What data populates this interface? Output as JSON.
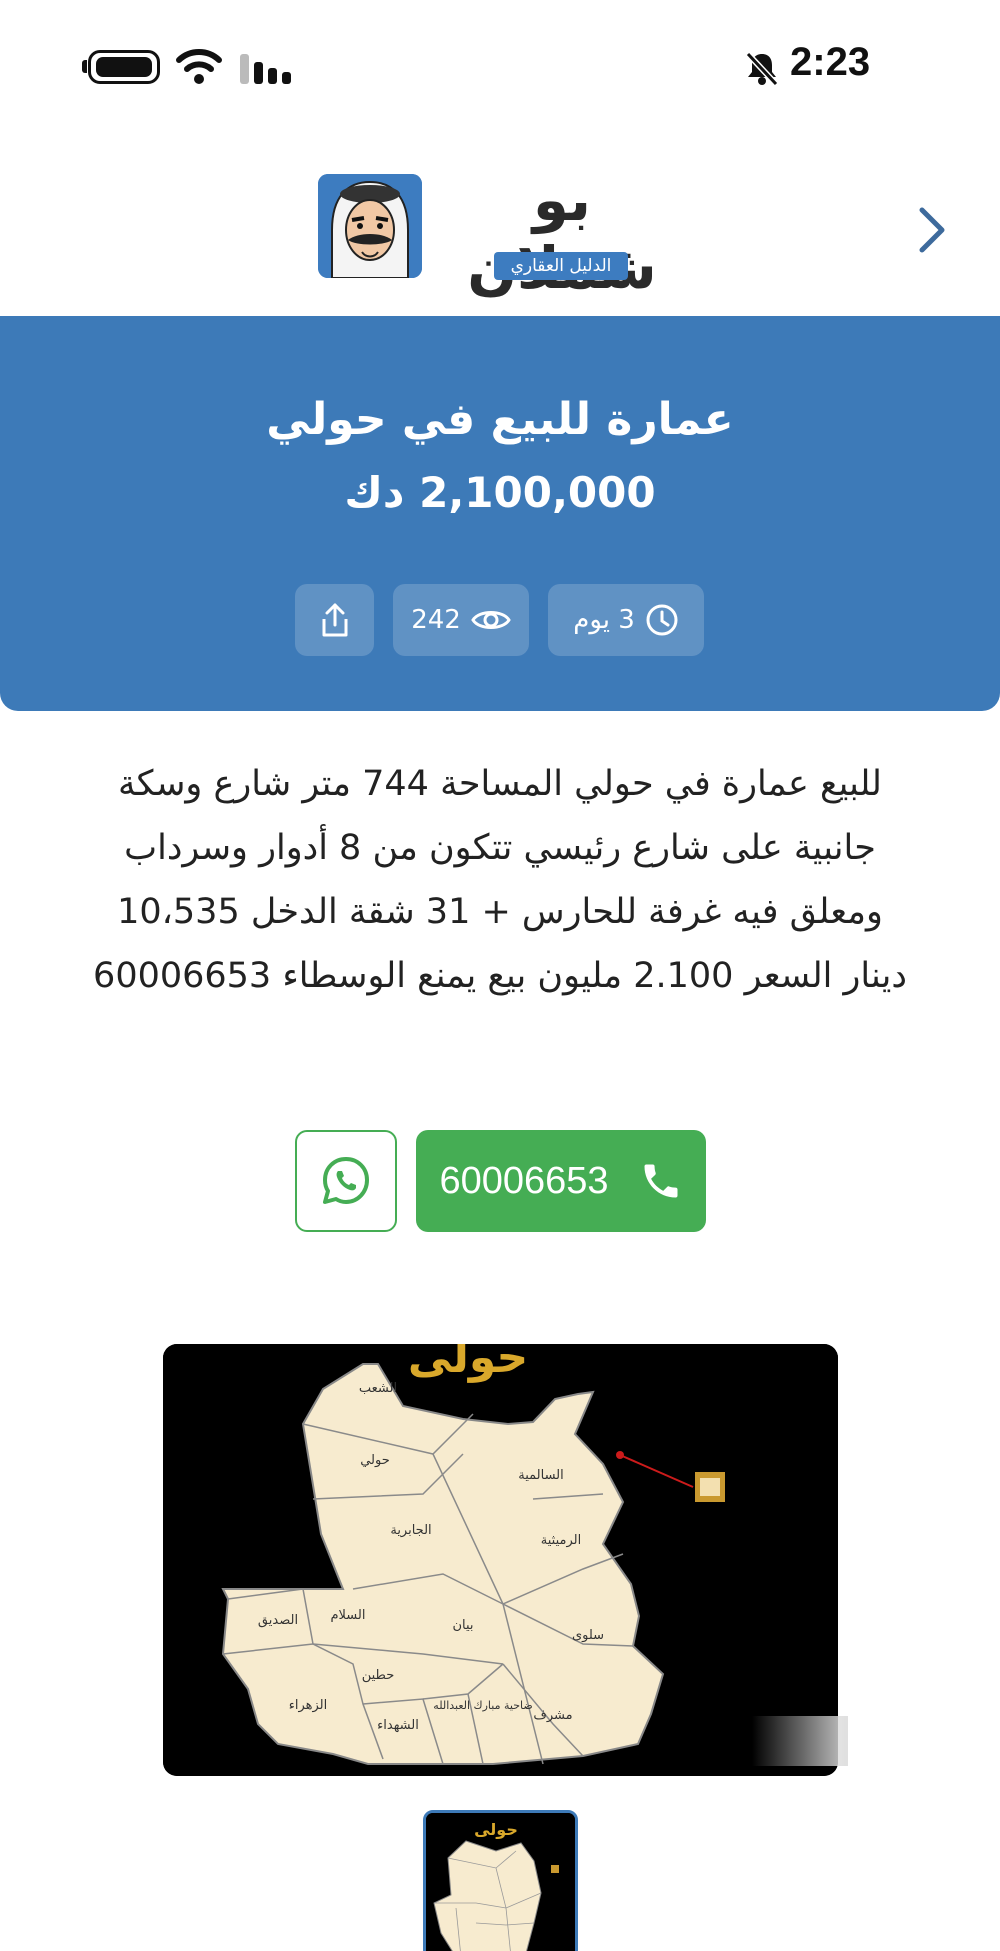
{
  "status_bar": {
    "time": "2:23",
    "icons": [
      "battery-icon",
      "wifi-icon",
      "signal-icon",
      "bell-off-icon"
    ]
  },
  "header": {
    "logo_title": "بو شملان",
    "logo_subtitle": "الدليل العقاري",
    "back_icon": "chevron-right-icon"
  },
  "listing": {
    "title": "عمارة للبيع في حولي",
    "price": "2,100,000 دك",
    "age": "3 يوم",
    "views": "242",
    "description": "للبيع عمارة في حولي المساحة 744 متر شارع وسكة جانبية على شارع رئيسي تتكون من 8 أدوار وسرداب ومعلق فيه غرفة للحارس + 31 شقة الدخل 10،535 دينار السعر 2.100 مليون بيع يمنع الوسطاء 60006653"
  },
  "contact": {
    "phone": "60006653"
  },
  "map": {
    "title": "حولى",
    "areas": [
      "الشعب",
      "حولي",
      "السالمية",
      "الجابرية",
      "الرميثية",
      "الصديق",
      "السلام",
      "بيان",
      "سلوى",
      "حطين",
      "الزهراء",
      "الشهداء",
      "ضاحية مبارك العبدالله",
      "مشرف"
    ]
  },
  "colors": {
    "brand_blue": "#3d7ab8",
    "call_green": "#45ad54",
    "map_land": "#f7ebcf",
    "map_title": "#d9a82b"
  }
}
